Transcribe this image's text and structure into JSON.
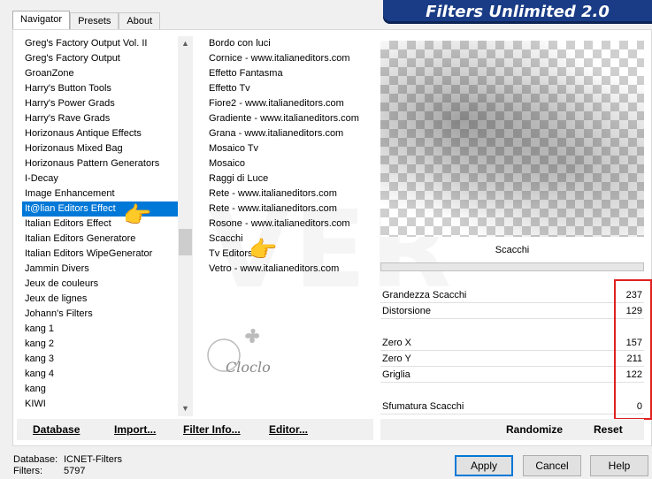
{
  "tabs": [
    "Navigator",
    "Presets",
    "About"
  ],
  "banner_title": "Filters Unlimited 2.0",
  "categories": [
    "Greg's Factory Output Vol. II",
    "Greg's Factory Output",
    "GroanZone",
    "Harry's Button Tools",
    "Harry's Power Grads",
    "Harry's Rave Grads",
    "Horizonaus Antique Effects",
    "Horizonaus Mixed Bag",
    "Horizonaus Pattern Generators",
    "I-Decay",
    "Image Enhancement",
    "It@lian Editors Effect",
    "Italian Editors Effect",
    "Italian Editors Generatore",
    "Italian Editors WipeGenerator",
    "Jammin Divers",
    "Jeux de couleurs",
    "Jeux de lignes",
    "Johann's Filters",
    "kang 1",
    "kang 2",
    "kang 3",
    "kang 4",
    "kang",
    "KIWI"
  ],
  "selected_category_index": 11,
  "filters": [
    "Bordo con luci",
    "Cornice - www.italianeditors.com",
    "Effetto Fantasma",
    "Effetto Tv",
    "Fiore2 - www.italianeditors.com",
    "Gradiente - www.italianeditors.com",
    "Grana - www.italianeditors.com",
    "Mosaico Tv",
    "Mosaico",
    "Raggi di Luce",
    "Rete - www.italianeditors.com",
    "Rete - www.italianeditors.com",
    "Rosone - www.italianeditors.com",
    "Scacchi",
    "Tv Editors",
    "Vetro - www.italianeditors.com"
  ],
  "selected_filter_name": "Scacchi",
  "params": [
    {
      "label": "Grandezza Scacchi",
      "value": "237"
    },
    {
      "label": "Distorsione",
      "value": "129"
    },
    {
      "label": "Zero X",
      "value": "157"
    },
    {
      "label": "Zero Y",
      "value": "211"
    },
    {
      "label": "Griglia",
      "value": "122"
    },
    {
      "label": "Sfumatura Scacchi",
      "value": "0"
    }
  ],
  "buttons_left": [
    "Database",
    "Import...",
    "Filter Info...",
    "Editor..."
  ],
  "buttons_right": [
    "Randomize",
    "Reset"
  ],
  "status": {
    "database_label": "Database:",
    "database_value": "ICNET-Filters",
    "filters_label": "Filters:",
    "filters_value": "5797"
  },
  "dialog_buttons": [
    "Apply",
    "Cancel",
    "Help"
  ],
  "watermark_text": "VER",
  "logo_text": "Cloclo",
  "colors": {
    "banner": "#1a3c86",
    "selection": "#0078d7",
    "highlight_box": "#e02020"
  }
}
